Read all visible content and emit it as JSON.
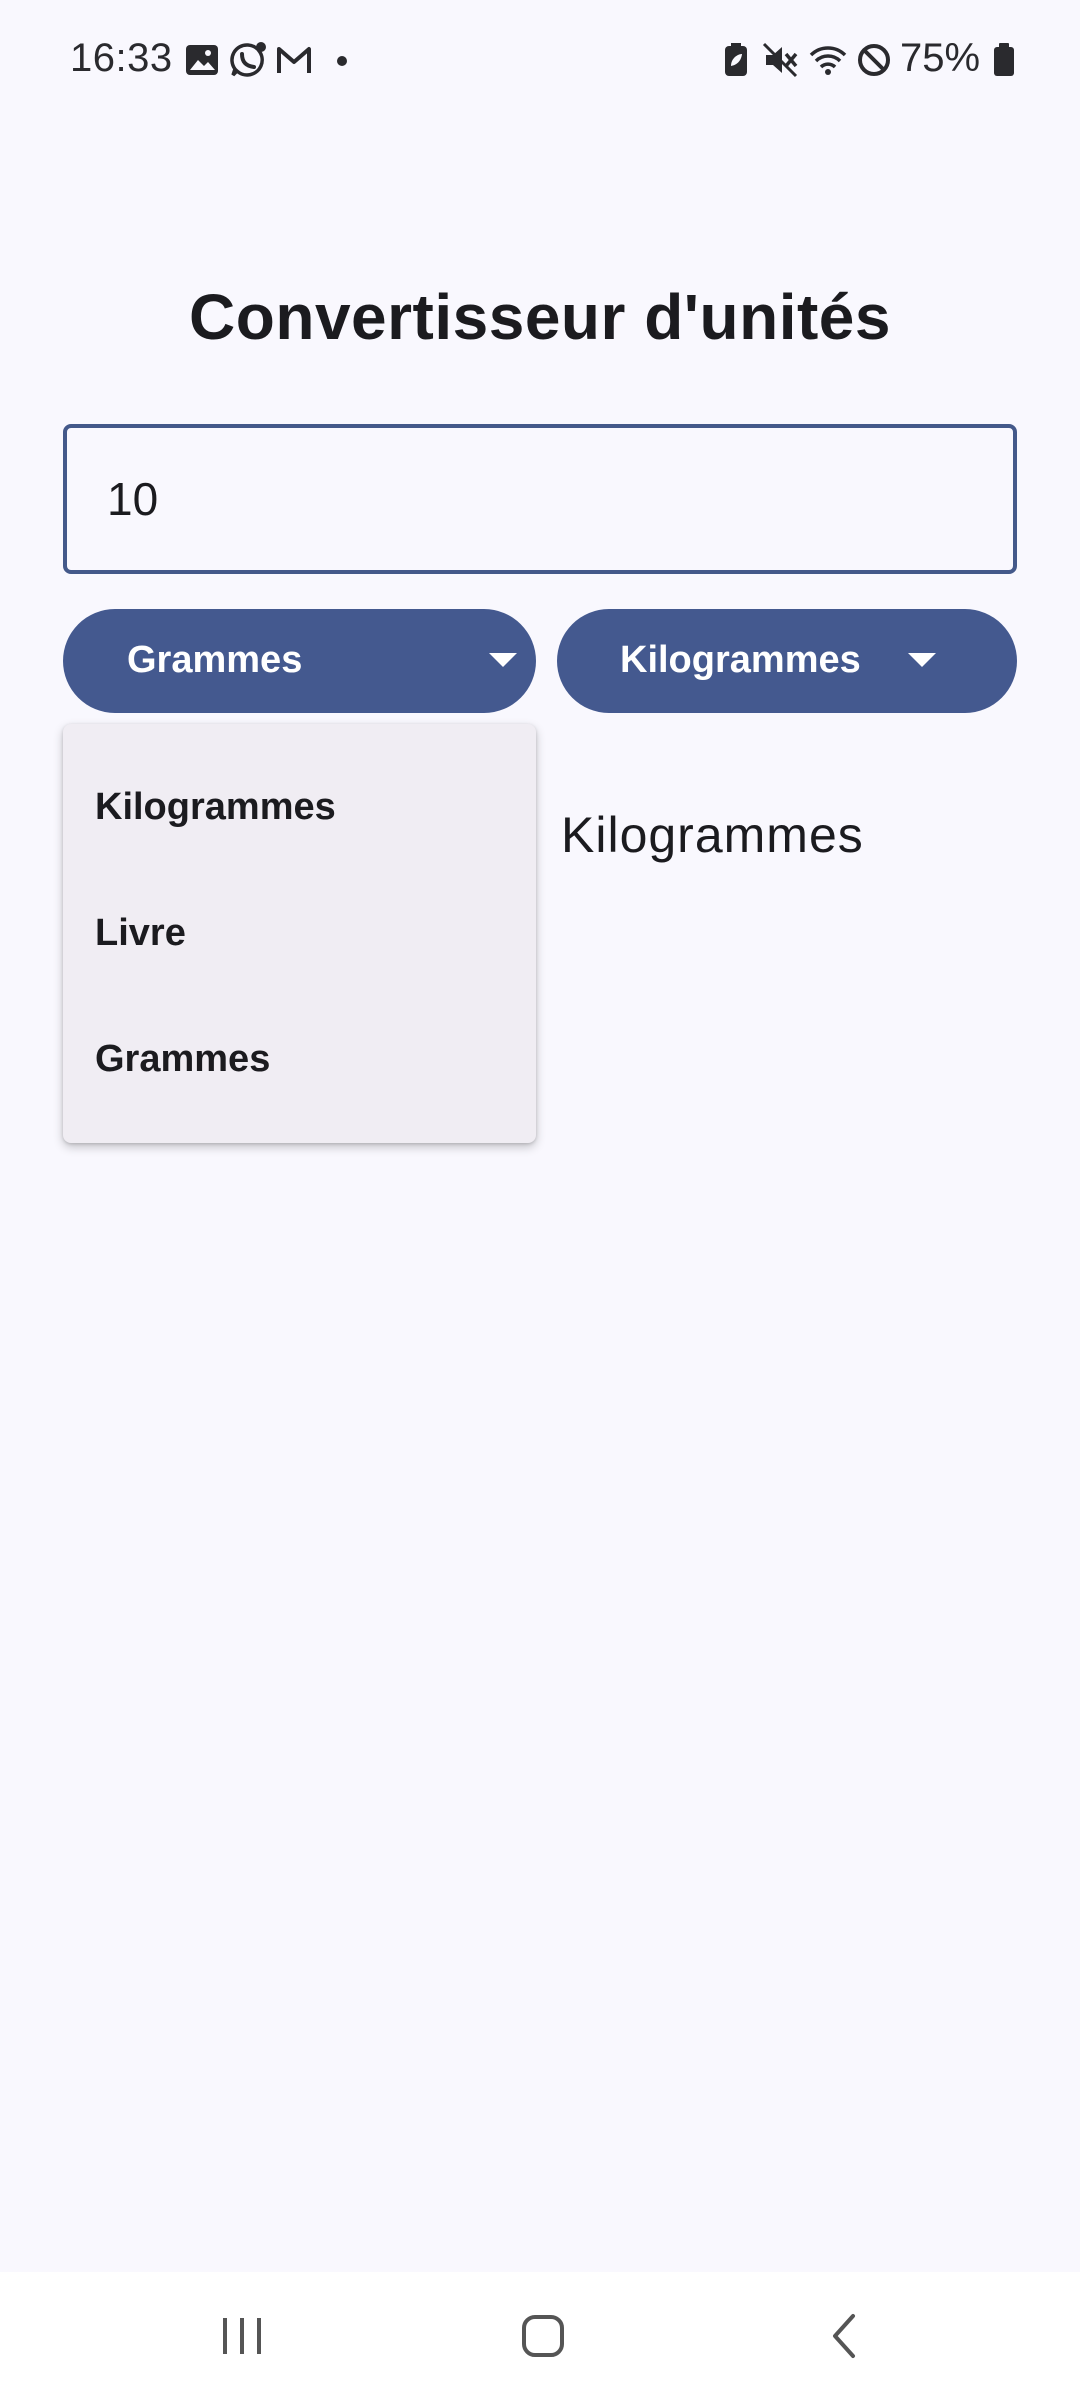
{
  "status_bar": {
    "time": "16:33",
    "left_icons": [
      "gallery-icon",
      "whatsapp-icon",
      "gmail-icon",
      "dot-icon"
    ],
    "right_icons": [
      "battery-saver-icon",
      "mute-icon",
      "wifi-icon",
      "do-not-disturb-icon",
      "battery-icon"
    ],
    "battery": "75%"
  },
  "app": {
    "title": "Convertisseur d'unités",
    "input_value": "10",
    "from_unit": "Grammes",
    "to_unit": "Kilogrammes",
    "result_text": "Kilogrammes",
    "menu_items": [
      "Kilogrammes",
      "Livre",
      "Grammes"
    ]
  },
  "nav_bar": {
    "buttons": [
      "recents-icon",
      "home-icon",
      "back-icon"
    ]
  },
  "colors": {
    "accent": "#44598f",
    "background": "#f9f8fe",
    "menu_background": "#f0edf3"
  }
}
